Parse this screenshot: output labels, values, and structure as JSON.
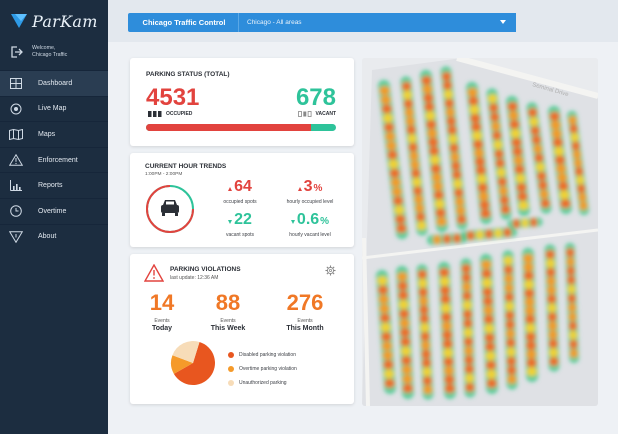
{
  "brand": {
    "name": "ParKam"
  },
  "user": {
    "welcome_line1": "Welcome,",
    "welcome_line2": "Chicago Traffic"
  },
  "sidebar": {
    "items": [
      {
        "label": "Dashboard",
        "icon": "dashboard-icon",
        "active": true
      },
      {
        "label": "Live Map",
        "icon": "live-map-icon"
      },
      {
        "label": "Maps",
        "icon": "maps-icon"
      },
      {
        "label": "Enforcement",
        "icon": "warning-icon"
      },
      {
        "label": "Reports",
        "icon": "reports-icon"
      },
      {
        "label": "Overtime",
        "icon": "clock-icon"
      },
      {
        "label": "About",
        "icon": "about-icon"
      }
    ]
  },
  "topbar": {
    "title": "Chicago Traffic Control",
    "area_select": "Chicago - All areas"
  },
  "parking_status": {
    "title": "PARKING STATUS (TOTAL)",
    "occupied": "4531",
    "occupied_label": "OCCUPIED",
    "vacant": "678",
    "vacant_label": "VACANT",
    "occupied_fraction": 0.87
  },
  "trends": {
    "title": "CURRENT HOUR TRENDS",
    "time_range": "1:00PM - 2:00PM",
    "occupied_spots": {
      "value": "64",
      "label": "occupied spots"
    },
    "hourly_occupied": {
      "value": "3",
      "unit": "%",
      "label": "hourly occupied level"
    },
    "vacant_spots": {
      "value": "22",
      "label": "vacant spots"
    },
    "hourly_vacant": {
      "value": "0.6",
      "unit": "%",
      "label": "hourly vacant level"
    }
  },
  "violations": {
    "title": "PARKING VIOLATIONS",
    "last_update": "last update: 12:36 AM",
    "events_word": "Events",
    "today": {
      "value": "14",
      "period": "Today"
    },
    "week": {
      "value": "88",
      "period": "This Week"
    },
    "month": {
      "value": "276",
      "period": "This Month"
    },
    "legend": [
      {
        "label": "Disabled parking violation",
        "color": "#e8561f"
      },
      {
        "label": "Overtime parking violation",
        "color": "#f59a2a"
      },
      {
        "label": "Unauthorized parking",
        "color": "#f7dcb8"
      }
    ],
    "pie_fractions": [
      0.62,
      0.14,
      0.24
    ]
  },
  "map": {
    "street_label": "Seminal Drive"
  },
  "colors": {
    "sidebar": "#1c2d40",
    "accent": "#2e8ddb",
    "red": "#e2433e",
    "green": "#2ec39a",
    "orange": "#f07826"
  }
}
